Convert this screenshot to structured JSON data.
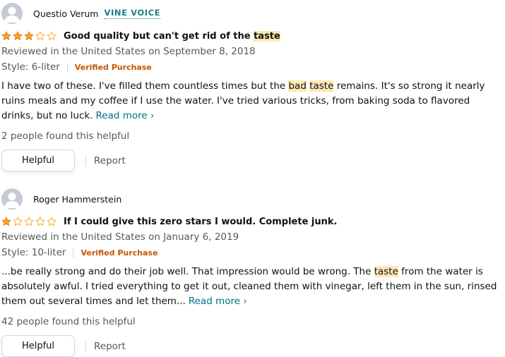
{
  "colors": {
    "star": "#ffa41c",
    "highlight": "#fde8b6",
    "link": "#007185",
    "verified": "#c45500",
    "vine": "#1a7f86"
  },
  "reviews": [
    {
      "reviewer": "Questio Verum",
      "badge": "VINE VOICE",
      "rating": 3,
      "title": [
        "Good quality but can't get rid of the ",
        "taste"
      ],
      "date": "Reviewed in the United States on September 8, 2018",
      "style": "Style: 6-liter",
      "verified": "Verified Purchase",
      "body": [
        "I have two of these. I've filled them countless times but the ",
        "bad",
        " ",
        "taste",
        " remains. It's so strong it nearly ruins meals and my coffee if I use the water. I've tried various tricks, from baking soda to flavored drinks, but no luck."
      ],
      "read_more": "Read more",
      "helpful_count": "2 people found this helpful",
      "helpful_label": "Helpful",
      "report_label": "Report"
    },
    {
      "reviewer": "Roger Hammerstein",
      "rating": 1,
      "title": [
        "If I could give this zero stars I would. Complete junk."
      ],
      "date": "Reviewed in the United States on January 6, 2019",
      "style": "Style: 10-liter",
      "verified": "Verified Purchase",
      "body": [
        "...be really strong and do their job well. That impression would be wrong. The ",
        "taste",
        " from the water is absolutely awful. I tried everything to get it out, cleaned them with vinegar, left them in the sun, rinsed them out several times and let them..."
      ],
      "read_more": "Read more",
      "helpful_count": "42 people found this helpful",
      "helpful_label": "Helpful",
      "report_label": "Report"
    }
  ]
}
